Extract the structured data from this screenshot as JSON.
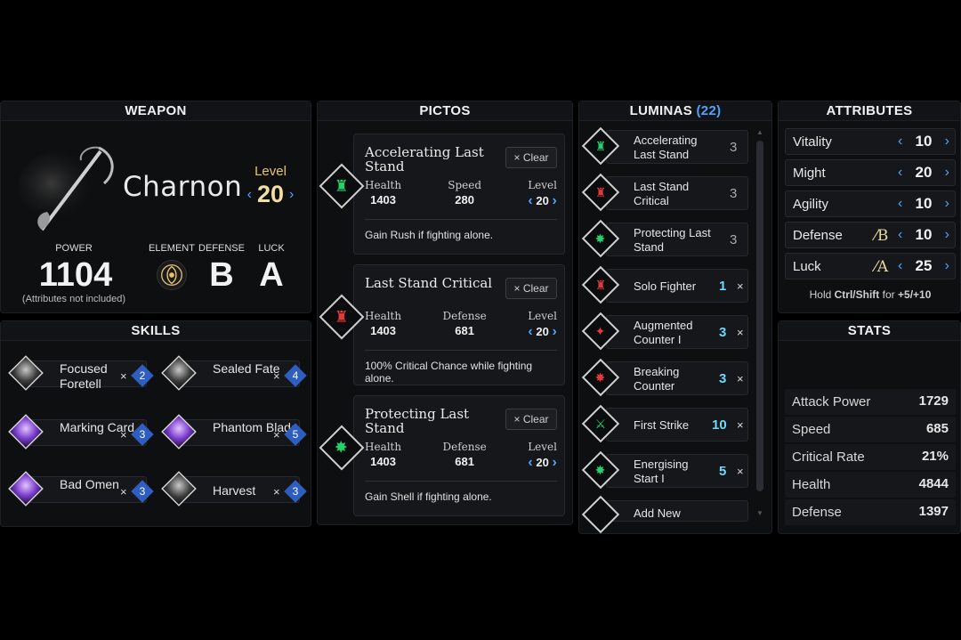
{
  "weapon": {
    "title": "WEAPON",
    "name": "Charnon",
    "level_label": "Level",
    "level": "20",
    "power_label": "POWER",
    "power": "1104",
    "power_note": "(Attributes not included)",
    "element_label": "ELEMENT",
    "defense_label": "DEFENSE",
    "defense": "B",
    "luck_label": "LUCK",
    "luck": "A"
  },
  "skills": {
    "title": "SKILLS",
    "items": [
      {
        "name": "Focused Foretell",
        "cost": "2"
      },
      {
        "name": "Sealed Fate",
        "cost": "4"
      },
      {
        "name": "Marking Card",
        "cost": "3"
      },
      {
        "name": "Phantom Blade",
        "cost": "5"
      },
      {
        "name": "Bad Omen",
        "cost": "3"
      },
      {
        "name": "Harvest",
        "cost": "3"
      }
    ]
  },
  "pictos": {
    "title": "PICTOS",
    "clear_label": "Clear",
    "items": [
      {
        "title": "Accelerating Last Stand",
        "s1_label": "Health",
        "s1": "1403",
        "s2_label": "Speed",
        "s2": "280",
        "level_label": "Level",
        "level": "20",
        "desc": "Gain Rush if fighting alone."
      },
      {
        "title": "Last Stand Critical",
        "s1_label": "Health",
        "s1": "1403",
        "s2_label": "Defense",
        "s2": "681",
        "level_label": "Level",
        "level": "20",
        "desc": "100% Critical Chance while fighting alone."
      },
      {
        "title": "Protecting Last Stand",
        "s1_label": "Health",
        "s1": "1403",
        "s2_label": "Defense",
        "s2": "681",
        "level_label": "Level",
        "level": "20",
        "desc": "Gain Shell if fighting alone."
      }
    ]
  },
  "luminas": {
    "title": "LUMINAS",
    "count": "(22)",
    "items": [
      {
        "name": "Accelerating Last Stand",
        "cost": "3"
      },
      {
        "name": "Last Stand Critical",
        "cost": "3"
      },
      {
        "name": "Protecting Last Stand",
        "cost": "3"
      },
      {
        "name": "Solo Fighter",
        "cost": "1"
      },
      {
        "name": "Augmented Counter I",
        "cost": "3"
      },
      {
        "name": "Breaking Counter",
        "cost": "3"
      },
      {
        "name": "First Strike",
        "cost": "10"
      },
      {
        "name": "Energising Start I",
        "cost": "5"
      }
    ],
    "add_new": "Add New"
  },
  "attributes": {
    "title": "ATTRIBUTES",
    "items": [
      {
        "name": "Vitality",
        "value": "10",
        "grade": ""
      },
      {
        "name": "Might",
        "value": "20",
        "grade": ""
      },
      {
        "name": "Agility",
        "value": "10",
        "grade": ""
      },
      {
        "name": "Defense",
        "value": "10",
        "grade": "B"
      },
      {
        "name": "Luck",
        "value": "25",
        "grade": "A"
      }
    ],
    "hint_prefix": "Hold",
    "hint_keys": "Ctrl/Shift",
    "hint_mid": "for",
    "hint_amount": "+5/+10"
  },
  "stats": {
    "title": "STATS",
    "items": [
      {
        "name": "Attack Power",
        "value": "1729"
      },
      {
        "name": "Speed",
        "value": "685"
      },
      {
        "name": "Critical Rate",
        "value": "21%"
      },
      {
        "name": "Health",
        "value": "4844"
      },
      {
        "name": "Defense",
        "value": "1397"
      }
    ]
  },
  "colors": {
    "accent": "#4ea3ff",
    "lumina_active_cost": "#6fd8ff",
    "level_gold": "#e8c36a",
    "skill_cost_blue": "#2e5ec0",
    "picto_green": "#22d36b",
    "picto_red": "#e23a3a"
  },
  "icons": {
    "weapon": "scythe-icon",
    "element": "element-void-icon",
    "chevron_left": "‹",
    "chevron_right": "›",
    "close": "×"
  }
}
